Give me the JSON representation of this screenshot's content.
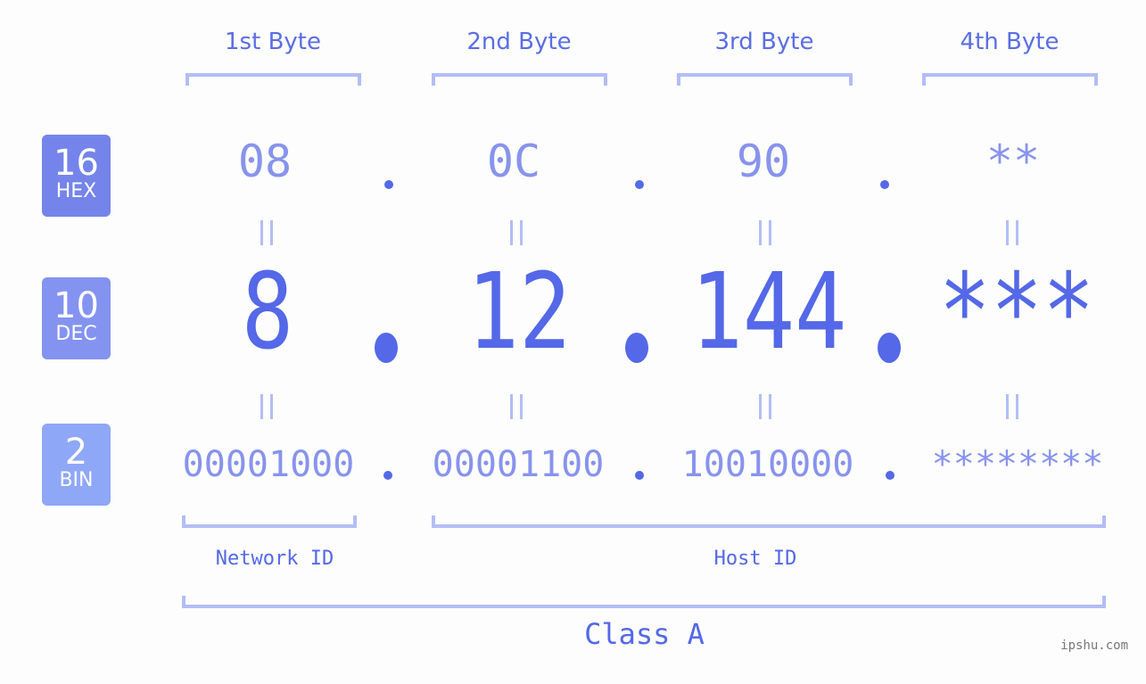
{
  "headers": [
    "1st Byte",
    "2nd Byte",
    "3rd Byte",
    "4th Byte"
  ],
  "badges": {
    "hex": {
      "number": "16",
      "label": "HEX",
      "color": "#7584ea"
    },
    "dec": {
      "number": "10",
      "label": "DEC",
      "color": "#8493f0"
    },
    "bin": {
      "number": "2",
      "label": "BIN",
      "color": "#8fa7f7"
    }
  },
  "hex": [
    "08",
    "0C",
    "90",
    "**"
  ],
  "dec": [
    "8",
    "12",
    "144",
    "***"
  ],
  "bin": [
    "00001000",
    "00001100",
    "10010000",
    "********"
  ],
  "separator": ".",
  "network_label": "Network ID",
  "host_label": "Host ID",
  "class_label": "Class A",
  "watermark": "ipshu.com",
  "colors": {
    "primary": "#5468e8",
    "light_value": "#8893ed",
    "bracket": "#b3bdf6",
    "background": "#fcfdfc"
  }
}
